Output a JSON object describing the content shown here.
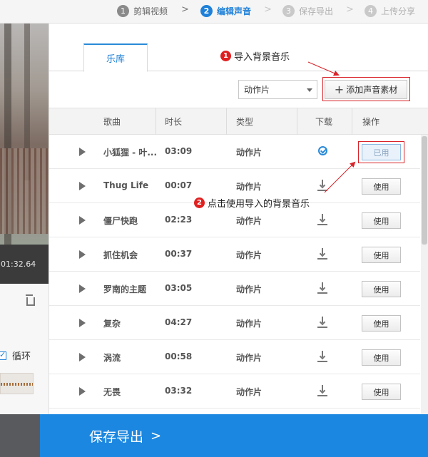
{
  "steps": [
    {
      "num": "1",
      "label": "剪辑视频",
      "state": "done"
    },
    {
      "num": "2",
      "label": "编辑声音",
      "state": "active"
    },
    {
      "num": "3",
      "label": "保存导出",
      "state": "future"
    },
    {
      "num": "4",
      "label": "上传分享",
      "state": "future"
    }
  ],
  "step_separator": ">",
  "left_panel": {
    "time": "01:32.64",
    "loop_label": "循环",
    "loop_checked": true
  },
  "library": {
    "tab_label": "乐库",
    "annotation_1": {
      "num": "1",
      "text": "导入背景音乐"
    },
    "annotation_2": {
      "num": "2",
      "text": "点击使用导入的背景音乐"
    },
    "category_select": "动作片",
    "add_button": {
      "icon": "+",
      "label": "添加声音素材"
    },
    "columns": [
      "歌曲",
      "时长",
      "类型",
      "下载",
      "操作"
    ],
    "rows": [
      {
        "name": "小狐狸 - 叶...",
        "duration": "03:09",
        "type": "动作片",
        "downloaded": true,
        "action": "已用"
      },
      {
        "name": "Thug Life",
        "duration": "00:07",
        "type": "动作片",
        "downloaded": false,
        "action": "使用"
      },
      {
        "name": "僵尸快跑",
        "duration": "02:23",
        "type": "动作片",
        "downloaded": false,
        "action": "使用"
      },
      {
        "name": "抓住机会",
        "duration": "00:37",
        "type": "动作片",
        "downloaded": false,
        "action": "使用"
      },
      {
        "name": "罗南的主题",
        "duration": "03:05",
        "type": "动作片",
        "downloaded": false,
        "action": "使用"
      },
      {
        "name": "复杂",
        "duration": "04:27",
        "type": "动作片",
        "downloaded": false,
        "action": "使用"
      },
      {
        "name": "涡流",
        "duration": "00:58",
        "type": "动作片",
        "downloaded": false,
        "action": "使用"
      },
      {
        "name": "无畏",
        "duration": "03:32",
        "type": "动作片",
        "downloaded": false,
        "action": "使用"
      }
    ]
  },
  "footer": {
    "save_label": "保存导出",
    "chevron": ">"
  },
  "colors": {
    "accent": "#1c87e0",
    "annotation_red": "#d8242a"
  }
}
